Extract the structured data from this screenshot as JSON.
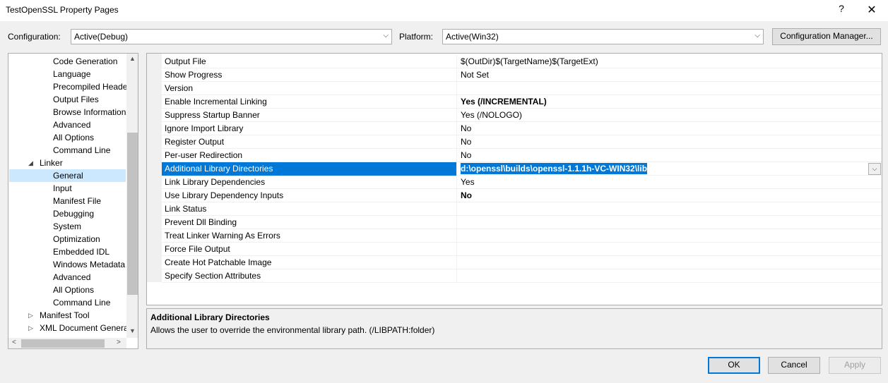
{
  "window": {
    "title": "TestOpenSSL Property Pages",
    "help_glyph": "?",
    "close_glyph": "✕"
  },
  "config_bar": {
    "configuration_label": "Configuration:",
    "configuration_value": "Active(Debug)",
    "platform_label": "Platform:",
    "platform_value": "Active(Win32)",
    "config_manager_label": "Configuration Manager..."
  },
  "tree": {
    "items": [
      {
        "label": "Code Generation"
      },
      {
        "label": "Language"
      },
      {
        "label": "Precompiled Heade"
      },
      {
        "label": "Output Files"
      },
      {
        "label": "Browse Information"
      },
      {
        "label": "Advanced"
      },
      {
        "label": "All Options"
      },
      {
        "label": "Command Line"
      },
      {
        "label": "Linker"
      },
      {
        "label": "General"
      },
      {
        "label": "Input"
      },
      {
        "label": "Manifest File"
      },
      {
        "label": "Debugging"
      },
      {
        "label": "System"
      },
      {
        "label": "Optimization"
      },
      {
        "label": "Embedded IDL"
      },
      {
        "label": "Windows Metadata"
      },
      {
        "label": "Advanced"
      },
      {
        "label": "All Options"
      },
      {
        "label": "Command Line"
      },
      {
        "label": "Manifest Tool"
      },
      {
        "label": "XML Document Genera"
      }
    ],
    "selected": "General",
    "expanded_glyph": "◢",
    "collapsed_glyph": "▷"
  },
  "properties": [
    {
      "name": "Output File",
      "value": "$(OutDir)$(TargetName)$(TargetExt)"
    },
    {
      "name": "Show Progress",
      "value": "Not Set"
    },
    {
      "name": "Version",
      "value": ""
    },
    {
      "name": "Enable Incremental Linking",
      "value": "Yes (/INCREMENTAL)"
    },
    {
      "name": "Suppress Startup Banner",
      "value": "Yes (/NOLOGO)"
    },
    {
      "name": "Ignore Import Library",
      "value": "No"
    },
    {
      "name": "Register Output",
      "value": "No"
    },
    {
      "name": "Per-user Redirection",
      "value": "No"
    },
    {
      "name": "Additional Library Directories",
      "value": "d:\\openssl\\builds\\openssl-1.1.1h-VC-WIN32\\lib"
    },
    {
      "name": "Link Library Dependencies",
      "value": "Yes"
    },
    {
      "name": "Use Library Dependency Inputs",
      "value": "No"
    },
    {
      "name": "Link Status",
      "value": ""
    },
    {
      "name": "Prevent Dll Binding",
      "value": ""
    },
    {
      "name": "Treat Linker Warning As Errors",
      "value": ""
    },
    {
      "name": "Force File Output",
      "value": ""
    },
    {
      "name": "Create Hot Patchable Image",
      "value": ""
    },
    {
      "name": "Specify Section Attributes",
      "value": ""
    }
  ],
  "description": {
    "title": "Additional Library Directories",
    "text": "Allows the user to override the environmental library path. (/LIBPATH:folder)"
  },
  "buttons": {
    "ok": "OK",
    "cancel": "Cancel",
    "apply": "Apply"
  },
  "colors": {
    "selection": "#0078d7",
    "tree_selection": "#cce8ff"
  }
}
